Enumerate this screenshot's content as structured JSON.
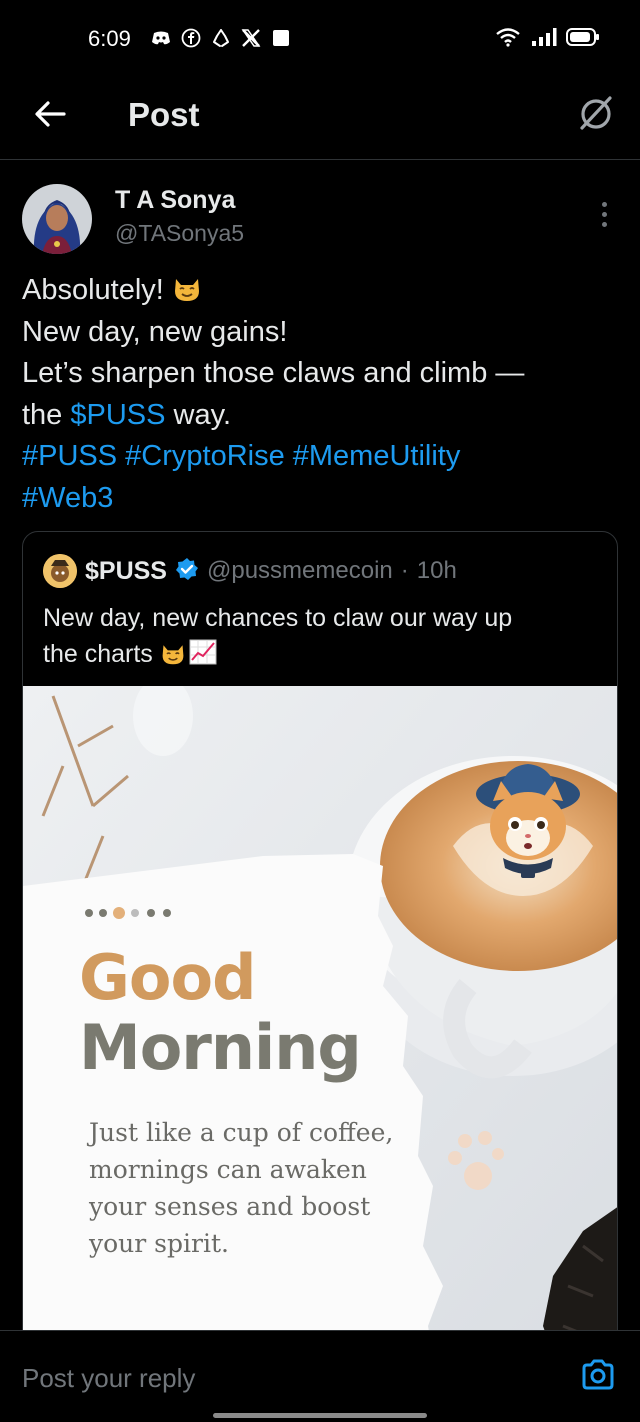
{
  "status_bar": {
    "time": "6:09",
    "left_icons": [
      "discord-icon",
      "facebook-icon",
      "recycle-icon",
      "x-icon",
      "square-icon"
    ],
    "right_icons": [
      "wifi-icon",
      "signal-icon",
      "battery-icon"
    ]
  },
  "header": {
    "title": "Post",
    "back_icon": "arrow-left-icon",
    "grok_icon": "grok-icon"
  },
  "post": {
    "author_name": "T A Sonya",
    "author_handle": "@TASonya5",
    "lines": {
      "l1": "Absolutely! ",
      "l2": "New day, new gains!",
      "l3": "Let’s sharpen those claws and climb —",
      "l4_pre": "the ",
      "l4_link": "$PUSS",
      "l4_post": " way.",
      "hashtags1": "#PUSS #CryptoRise #MemeUtility",
      "hashtags2": "#Web3"
    }
  },
  "quote": {
    "name": "$PUSS",
    "handle": "@pussmemecoin",
    "separator": "·",
    "time": "10h",
    "text_line1": "New day, new chances to claw our way up",
    "text_line2": "the charts ",
    "image": {
      "title1": "Good",
      "title2": "Morning",
      "subtitle_lines": [
        "Just like a cup of coffee,",
        "mornings can awaken",
        "your senses and boost",
        "your spirit."
      ]
    }
  },
  "reply": {
    "placeholder": "Post your reply",
    "camera_icon": "camera-icon"
  },
  "colors": {
    "background": "#000000",
    "link": "#1d9bf0",
    "secondary_text": "#71767b",
    "divider": "#2f3336",
    "good_color": "#d19a5e",
    "morning_color": "#7a7a70"
  }
}
